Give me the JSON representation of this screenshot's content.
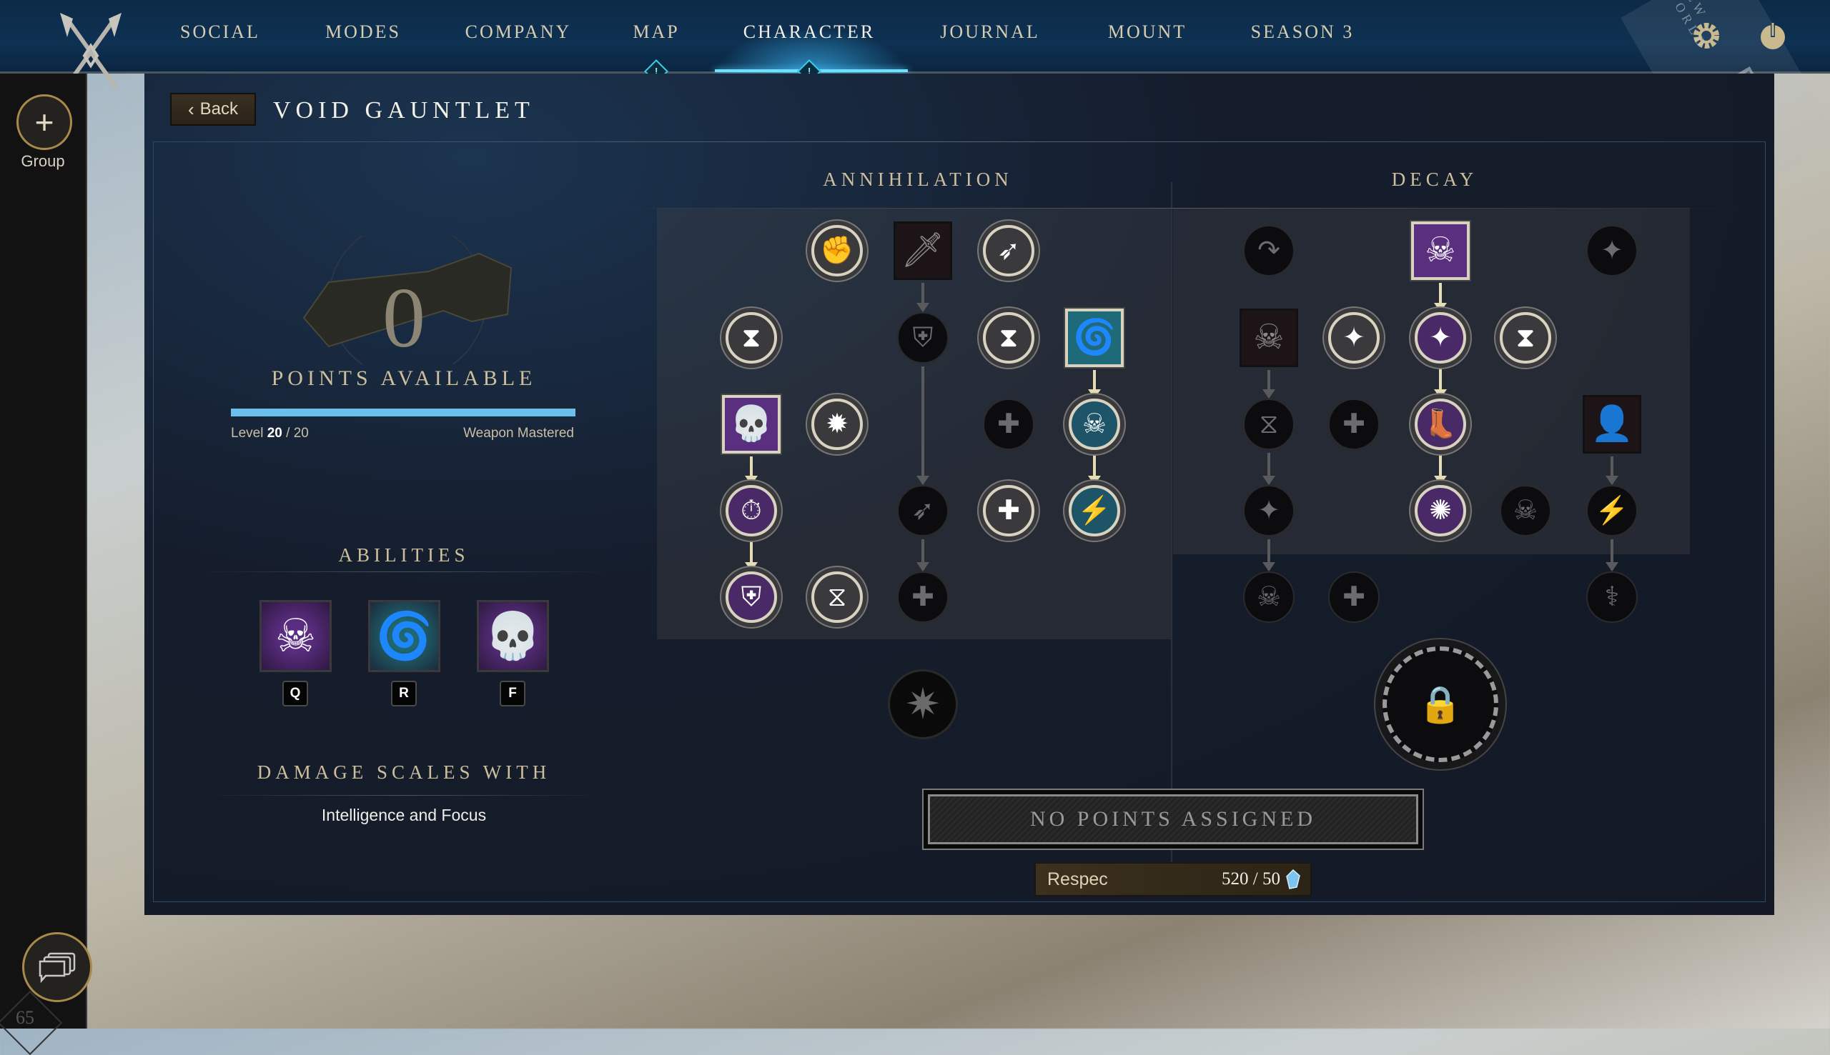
{
  "nav": {
    "items": [
      {
        "label": "SOCIAL",
        "active": false,
        "alert": false
      },
      {
        "label": "MODES",
        "active": false,
        "alert": false
      },
      {
        "label": "COMPANY",
        "active": false,
        "alert": false
      },
      {
        "label": "MAP",
        "active": false,
        "alert": true
      },
      {
        "label": "CHARACTER",
        "active": true,
        "alert": true
      },
      {
        "label": "JOURNAL",
        "active": false,
        "alert": false
      },
      {
        "label": "MOUNT",
        "active": false,
        "alert": false
      },
      {
        "label": "SEASON 3",
        "active": false,
        "alert": false
      }
    ],
    "alert_glyph": "!",
    "settings_icon": "gear-icon",
    "power_icon": "power-icon",
    "watermark": {
      "brand": "NEW WORLD",
      "label": "PTR BUILD"
    }
  },
  "sidebar": {
    "group_label": "Group",
    "group_icon": "+",
    "chat_icon": "chat-bubbles-icon",
    "level_badge": "65"
  },
  "page": {
    "back_label": "Back",
    "title": "VOID GAUNTLET"
  },
  "summary": {
    "points_available": "0",
    "points_label": "POINTS AVAILABLE",
    "progress_fraction": 1.0,
    "level_label": "Level",
    "level_current": "20",
    "level_sep": " / ",
    "level_max": "20",
    "status": "Weapon Mastered",
    "abilities_title": "ABILITIES",
    "abilities": [
      {
        "key": "Q",
        "icon": "skull-vortex-icon",
        "glyph": "☠",
        "color": "#5b2d82"
      },
      {
        "key": "R",
        "icon": "void-swirl-icon",
        "glyph": "🌀",
        "color": "#1f6670"
      },
      {
        "key": "F",
        "icon": "screaming-skull-icon",
        "glyph": "💀",
        "color": "#5a2f80"
      }
    ],
    "damage_title": "DAMAGE SCALES WITH",
    "damage_attributes": "Intelligence and Focus"
  },
  "trees": [
    {
      "title": "ANNIHILATION",
      "rows": [
        [
          null,
          {
            "id": "a1",
            "icon": "fist-icon",
            "g": "✊",
            "shape": "circle",
            "state": "lit"
          },
          {
            "id": "a2",
            "icon": "blade-icon",
            "g": "🗡",
            "shape": "square",
            "state": "dark",
            "to": "a6"
          },
          {
            "id": "a3",
            "icon": "rising-flame-icon",
            "g": "➶",
            "shape": "circle",
            "state": "lit"
          },
          null
        ],
        [
          {
            "id": "a4",
            "icon": "hourglass-burst-icon",
            "g": "⧗",
            "shape": "circle",
            "state": "lit"
          },
          null,
          {
            "id": "a6",
            "icon": "armor-icon",
            "g": "⛨",
            "shape": "circle",
            "state": "dark",
            "to": "a12"
          },
          {
            "id": "a7",
            "icon": "flame-hourglass-icon",
            "g": "⧗",
            "shape": "circle",
            "state": "lit"
          },
          {
            "id": "a8",
            "icon": "void-swirl-icon",
            "g": "🌀",
            "shape": "square",
            "state": "teal",
            "to": "a11"
          }
        ],
        [
          {
            "id": "a9",
            "icon": "screaming-skull-icon",
            "g": "💀",
            "shape": "square",
            "state": "purple",
            "to": "a13"
          },
          {
            "id": "a10",
            "icon": "star-arrow-up-icon",
            "g": "✹",
            "shape": "circle",
            "state": "lit"
          },
          null,
          {
            "id": "a10b",
            "icon": "plus-icon",
            "g": "✚",
            "shape": "circle",
            "state": "dark"
          },
          {
            "id": "a11",
            "icon": "crumbling-skull-icon",
            "g": "☠",
            "shape": "circle",
            "state": "teal",
            "to": "a15"
          }
        ],
        [
          {
            "id": "a13",
            "icon": "stopwatch-icon",
            "g": "⏱",
            "shape": "circle",
            "state": "purple",
            "to": "a16"
          },
          null,
          {
            "id": "a12",
            "icon": "rising-flame-icon",
            "g": "➶",
            "shape": "circle",
            "state": "dark",
            "to": "a18"
          },
          {
            "id": "a14",
            "icon": "radiant-plus-icon",
            "g": "✚",
            "shape": "circle",
            "state": "lit"
          },
          {
            "id": "a15",
            "icon": "group-lightning-icon",
            "g": "⚡",
            "shape": "circle",
            "state": "teal"
          }
        ],
        [
          {
            "id": "a16",
            "icon": "armor-icon",
            "g": "⛨",
            "shape": "circle",
            "state": "purple"
          },
          {
            "id": "a17",
            "icon": "hourglass-cycle-icon",
            "g": "⧖",
            "shape": "circle",
            "state": "lit"
          },
          {
            "id": "a18",
            "icon": "radiant-plus-icon",
            "g": "✚",
            "shape": "circle",
            "state": "dark"
          },
          null,
          null
        ]
      ],
      "ultimate": {
        "icon": "radiant-figure-icon",
        "g": "✷",
        "locked": false
      }
    },
    {
      "title": "DECAY",
      "rows": [
        [
          {
            "id": "d1",
            "icon": "curved-arrow-icon",
            "g": "↷",
            "shape": "circle",
            "state": "dark"
          },
          null,
          {
            "id": "d2",
            "icon": "skull-vortex-icon",
            "g": "☠",
            "shape": "square",
            "state": "purple",
            "to": "d6"
          },
          null,
          {
            "id": "d3",
            "icon": "sparkle-plus-icon",
            "g": "✦",
            "shape": "circle",
            "state": "dark"
          }
        ],
        [
          {
            "id": "d4",
            "icon": "skull-slash-icon",
            "g": "☠",
            "shape": "square",
            "state": "dark",
            "to": "d8"
          },
          {
            "id": "d5",
            "icon": "sparkle-minus-icon",
            "g": "✦",
            "shape": "circle",
            "state": "lit"
          },
          {
            "id": "d6",
            "icon": "sparkle-plus-icon",
            "g": "✦",
            "shape": "circle",
            "state": "purple",
            "to": "d10"
          },
          {
            "id": "d7",
            "icon": "hourglass-down-icon",
            "g": "⧗",
            "shape": "circle",
            "state": "lit"
          },
          null
        ],
        [
          {
            "id": "d8",
            "icon": "hourglass-cycle-icon",
            "g": "⧖",
            "shape": "circle",
            "state": "dark",
            "to": "d12"
          },
          {
            "id": "d9",
            "icon": "badge-plus-icon",
            "g": "✚",
            "shape": "circle",
            "state": "dark"
          },
          {
            "id": "d10",
            "icon": "boot-slash-icon",
            "g": "👢",
            "shape": "circle",
            "state": "purple",
            "to": "d13"
          },
          null,
          {
            "id": "d11",
            "icon": "vortex-figure-icon",
            "g": "👤",
            "shape": "square",
            "state": "dark",
            "to": "d15"
          }
        ],
        [
          {
            "id": "d12",
            "icon": "shield-sparkle-icon",
            "g": "✦",
            "shape": "circle",
            "state": "dark",
            "to": "d16"
          },
          null,
          {
            "id": "d13",
            "icon": "burst-icon",
            "g": "✺",
            "shape": "circle",
            "state": "purple"
          },
          {
            "id": "d14",
            "icon": "skull-hourglass-icon",
            "g": "☠",
            "shape": "circle",
            "state": "dark"
          },
          {
            "id": "d15",
            "icon": "lightning-cycle-icon",
            "g": "⚡",
            "shape": "circle",
            "state": "dark",
            "to": "d19"
          }
        ],
        [
          {
            "id": "d16",
            "icon": "skull-plus-icon",
            "g": "☠",
            "shape": "circle",
            "state": "dark"
          },
          {
            "id": "d17",
            "icon": "broken-plus-icon",
            "g": "✚",
            "shape": "circle",
            "state": "dark"
          },
          null,
          null,
          {
            "id": "d19",
            "icon": "group-plus-icon",
            "g": "⚕",
            "shape": "circle",
            "state": "dark"
          }
        ]
      ],
      "ultimate": {
        "icon": "locked-eye-icon",
        "g": "🔒",
        "locked": true
      }
    }
  ],
  "footer": {
    "assign_label": "NO POINTS ASSIGNED",
    "respec_label": "Respec",
    "respec_cost": "520 / 50",
    "currency_icon": "azoth-crystal-icon",
    "currency_color": "#7cc4ee"
  }
}
